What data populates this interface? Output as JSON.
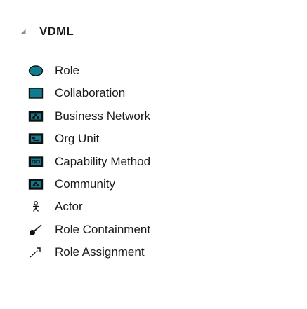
{
  "toolbox": {
    "group": {
      "title": "VDML",
      "expanded": true,
      "icon": "collapse-triangle-icon"
    },
    "colors": {
      "icon_fill": "#0f7b8e",
      "icon_dark": "#111111",
      "text": "#1a1a1a",
      "border": "#d9d9d9"
    },
    "items": [
      {
        "label": "Role",
        "icon": "role-ellipse-icon"
      },
      {
        "label": "Collaboration",
        "icon": "collaboration-rectangle-icon"
      },
      {
        "label": "Business Network",
        "icon": "business-network-icon"
      },
      {
        "label": "Org Unit",
        "icon": "org-unit-icon"
      },
      {
        "label": "Capability Method",
        "icon": "capability-method-icon"
      },
      {
        "label": "Community",
        "icon": "community-icon"
      },
      {
        "label": "Actor",
        "icon": "actor-icon"
      },
      {
        "label": "Role Containment",
        "icon": "role-containment-icon"
      },
      {
        "label": "Role Assignment",
        "icon": "role-assignment-icon"
      }
    ]
  }
}
